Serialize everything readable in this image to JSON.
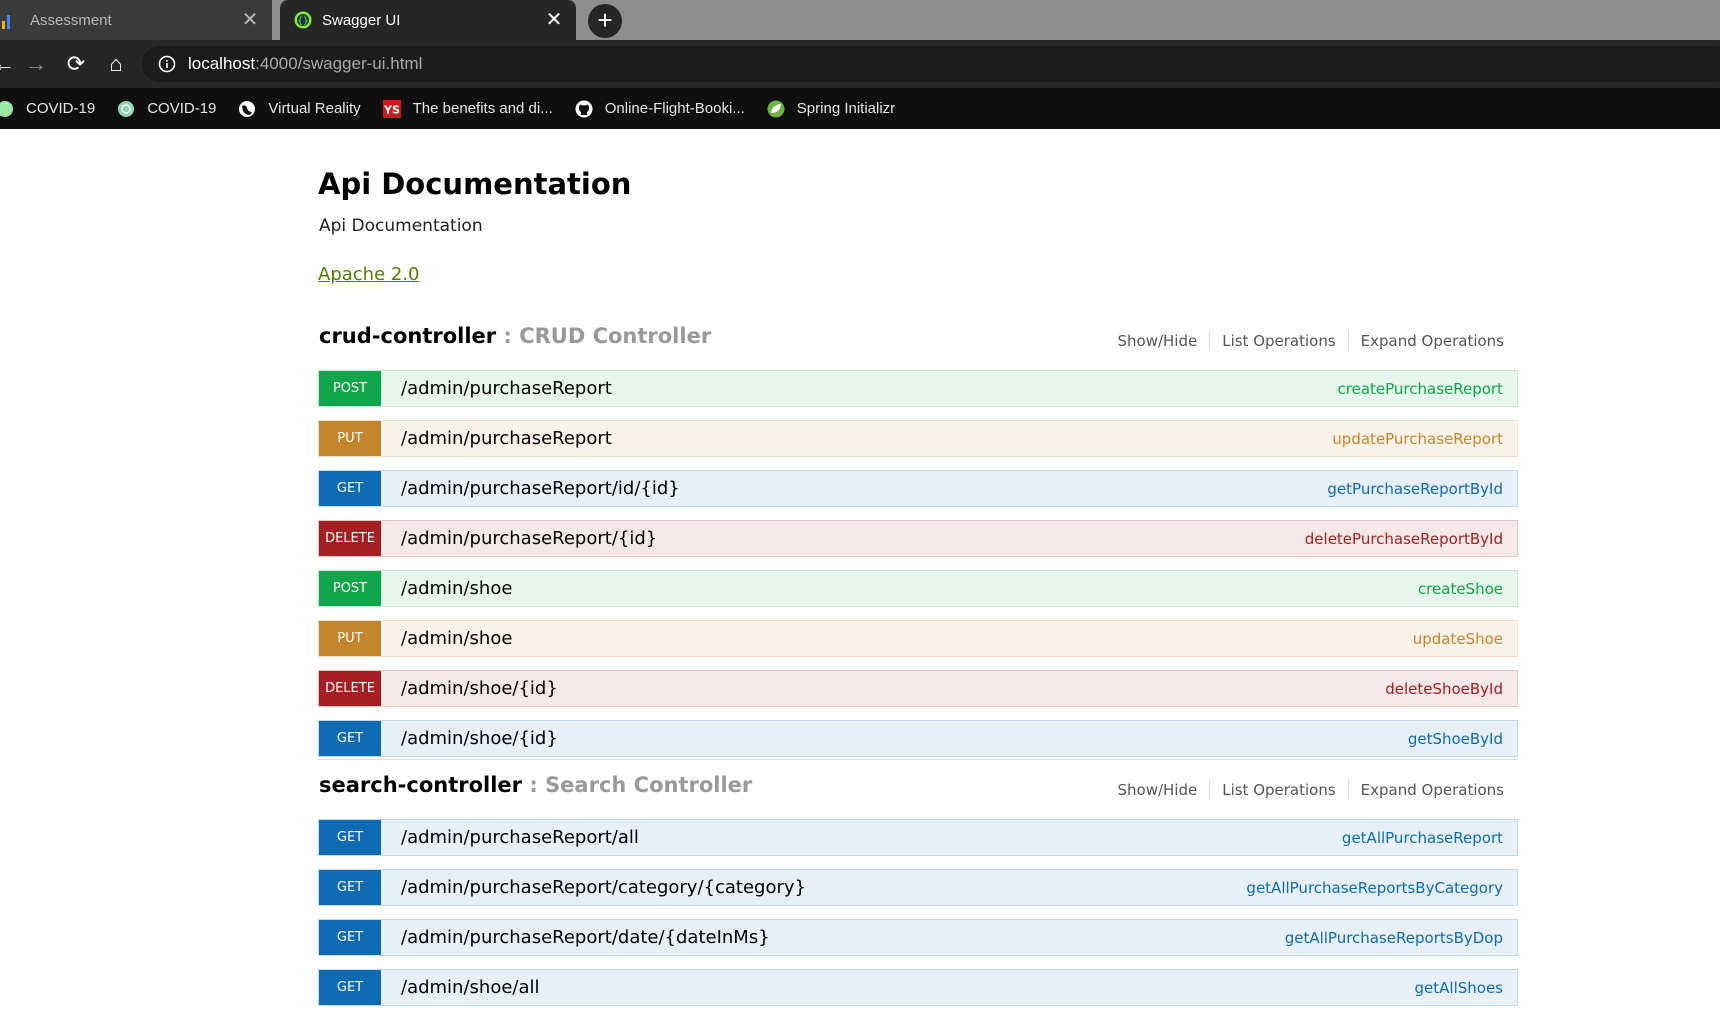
{
  "browser": {
    "tabs": [
      {
        "title": "Assessment",
        "active": false
      },
      {
        "title": "Swagger UI",
        "active": true
      }
    ],
    "close_glyph": "✕",
    "new_tab_glyph": "+",
    "nav": {
      "back": "←",
      "forward": "→",
      "reload": "⟳",
      "home": "⌂"
    },
    "url": {
      "host": "localhost",
      "rest": ":4000/swagger-ui.html"
    },
    "bookmarks": [
      {
        "label": "COVID-19",
        "icon": "covid-icon"
      },
      {
        "label": "COVID-19",
        "icon": "covid-globe-icon"
      },
      {
        "label": "Virtual Reality",
        "icon": "globe-icon"
      },
      {
        "label": "The benefits and di...",
        "icon": "ys-icon"
      },
      {
        "label": "Online-Flight-Booki...",
        "icon": "github-icon"
      },
      {
        "label": "Spring Initializr",
        "icon": "spring-icon"
      }
    ]
  },
  "colors": {
    "post": "#10a54a",
    "put": "#c5862b",
    "get": "#0f6ab4",
    "delete": "#a41e22",
    "license": "#547f00"
  },
  "page": {
    "title": "Api Documentation",
    "description": "Api Documentation",
    "license": "Apache 2.0"
  },
  "resource_links": {
    "show_hide": "Show/Hide",
    "list_operations": "List Operations",
    "expand_operations": "Expand Operations"
  },
  "resources": [
    {
      "name": "crud-controller",
      "separator": " : ",
      "description": "CRUD Controller",
      "operations": [
        {
          "method": "POST",
          "path": "/admin/purchaseReport",
          "summary": "createPurchaseReport"
        },
        {
          "method": "PUT",
          "path": "/admin/purchaseReport",
          "summary": "updatePurchaseReport"
        },
        {
          "method": "GET",
          "path": "/admin/purchaseReport/id/{id}",
          "summary": "getPurchaseReportById"
        },
        {
          "method": "DELETE",
          "path": "/admin/purchaseReport/{id}",
          "summary": "deletePurchaseReportById"
        },
        {
          "method": "POST",
          "path": "/admin/shoe",
          "summary": "createShoe"
        },
        {
          "method": "PUT",
          "path": "/admin/shoe",
          "summary": "updateShoe"
        },
        {
          "method": "DELETE",
          "path": "/admin/shoe/{id}",
          "summary": "deleteShoeById"
        },
        {
          "method": "GET",
          "path": "/admin/shoe/{id}",
          "summary": "getShoeById"
        }
      ]
    },
    {
      "name": "search-controller",
      "separator": " : ",
      "description": "Search Controller",
      "operations": [
        {
          "method": "GET",
          "path": "/admin/purchaseReport/all",
          "summary": "getAllPurchaseReport"
        },
        {
          "method": "GET",
          "path": "/admin/purchaseReport/category/{category}",
          "summary": "getAllPurchaseReportsByCategory"
        },
        {
          "method": "GET",
          "path": "/admin/purchaseReport/date/{dateInMs}",
          "summary": "getAllPurchaseReportsByDop"
        },
        {
          "method": "GET",
          "path": "/admin/shoe/all",
          "summary": "getAllShoes"
        }
      ]
    }
  ]
}
